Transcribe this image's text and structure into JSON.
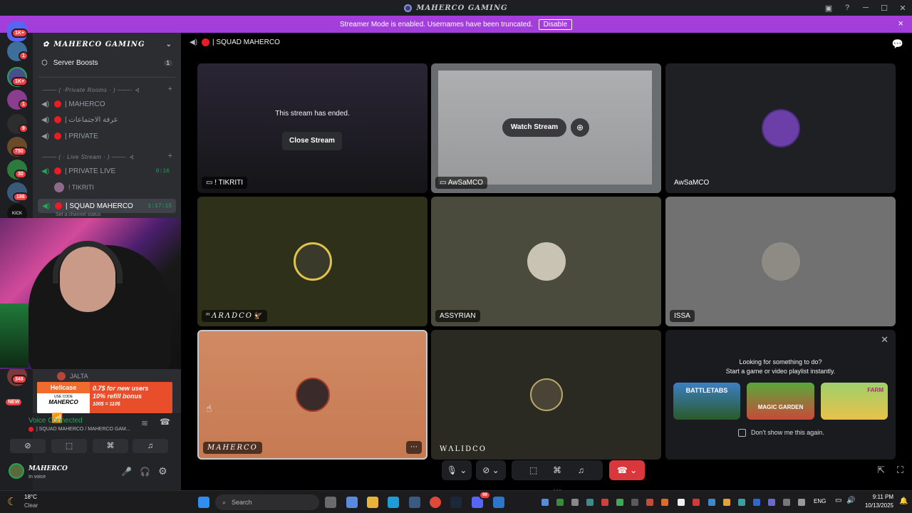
{
  "window": {
    "title": "MAHERCO GAMING",
    "controls": [
      "minimize-icon",
      "maximize-icon",
      "close-icon"
    ]
  },
  "banner": {
    "text": "Streamer Mode is enabled. Usernames have been truncated.",
    "disable_label": "Disable",
    "close": "×"
  },
  "rail": {
    "badges": [
      "1K+",
      "1",
      "1K+",
      "1",
      "9",
      "750",
      "30",
      "186",
      "348"
    ],
    "new_label": "NEW",
    "kick_label": "KICK"
  },
  "sidebar": {
    "server_name": "MAHERCO GAMING",
    "boosts_label": "Server Boosts",
    "boosts_count": "1",
    "categories": [
      {
        "label": "·─── ( ·Private Rooms · ) ───· ⊰"
      },
      {
        "label": "·─── ( · Live Stream · ) ───· ⊰"
      }
    ],
    "private_channels": [
      "| MAHERCO",
      "| غرفة الاجتماعات",
      "| PRIVATE"
    ],
    "live_channels": [
      {
        "name": "| PRIVATE LIVE",
        "timer": "0:16"
      },
      {
        "name": "! TIKRITI",
        "timer": ""
      },
      {
        "name": "| SQUAD MAHERCO",
        "timer": "1:17:15"
      }
    ],
    "channel_status": "Set a channel status",
    "jalta_label": "JALTA"
  },
  "ad": {
    "brand": "Hellcase",
    "use_code_label": "USE CODE",
    "code": "MAHERCO",
    "line1": "0.7$ for new users",
    "line2": "10% refill bonus",
    "line3": "100$ = 110$"
  },
  "voice": {
    "status": "Voice Connected",
    "channel": "| SQUAD MAHERCO / MAHERCO GAM...",
    "user_name": "MAHERCO",
    "user_status": "In voice"
  },
  "header": {
    "channel": "| SQUAD MAHERCO"
  },
  "tiles": [
    {
      "name": "! TIKRITI",
      "message": "This stream has ended.",
      "button": "Close Stream"
    },
    {
      "name": "AwSaMCO",
      "button": "Watch Stream"
    },
    {
      "name": "AwSaMCO"
    },
    {
      "name": "ᵐΛRΛDCO🦅"
    },
    {
      "name": "ASSYRIAN"
    },
    {
      "name": "ISSA"
    },
    {
      "name": "MAHERCO"
    },
    {
      "name": "WΛLIDCO"
    }
  ],
  "activity": {
    "title": "Looking for something to do?",
    "subtitle": "Start a game or video playlist instantly.",
    "games": [
      "BATTLETABS",
      "MAGIC GARDEN",
      "FARM"
    ],
    "checkbox_label": "Don't show me this again."
  },
  "taskbar": {
    "weather_temp": "18°C",
    "weather_desc": "Clear",
    "search_placeholder": "Search",
    "language": "ENG",
    "time": "9:11 PM",
    "date": "10/13/2025",
    "discord_badge": "99"
  },
  "colors": {
    "accent": "#a43edb",
    "danger": "#da373c",
    "online": "#23a55a",
    "live": "#ed1c24"
  }
}
